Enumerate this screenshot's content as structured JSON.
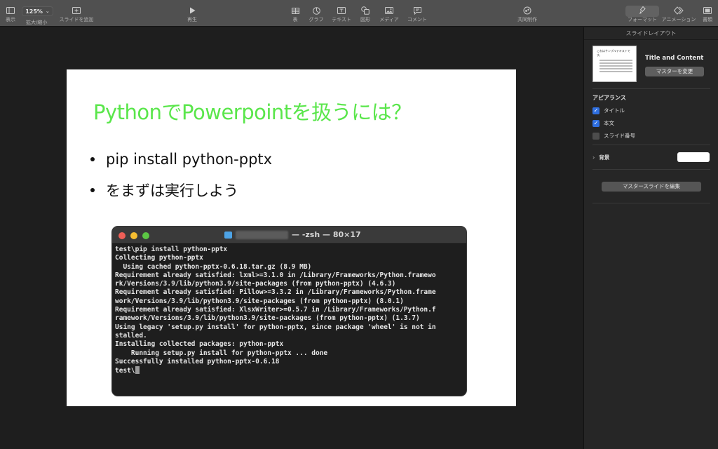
{
  "toolbar": {
    "view_label": "表示",
    "zoom_value": "125%",
    "zoom_label": "拡大/縮小",
    "add_slide_label": "スライドを追加",
    "play_label": "再生",
    "table_label": "表",
    "chart_label": "グラフ",
    "text_label": "テキスト",
    "shape_label": "図形",
    "media_label": "メディア",
    "comment_label": "コメント",
    "collaborate_label": "共同制作",
    "format_label": "フォーマット",
    "animate_label": "アニメーション",
    "document_label": "書類"
  },
  "slide": {
    "title": "PythonでPowerpointを扱うには？",
    "title_color": "#5ae64b",
    "bullets": [
      "pip install python-pptx",
      "をまずは実行しよう"
    ],
    "terminal": {
      "title": "— -zsh — 80×17",
      "lines": [
        "test\\pip install python-pptx",
        "Collecting python-pptx",
        "  Using cached python-pptx-0.6.18.tar.gz (8.9 MB)",
        "Requirement already satisfied: lxml>=3.1.0 in /Library/Frameworks/Python.framewo",
        "rk/Versions/3.9/lib/python3.9/site-packages (from python-pptx) (4.6.3)",
        "Requirement already satisfied: Pillow>=3.3.2 in /Library/Frameworks/Python.frame",
        "work/Versions/3.9/lib/python3.9/site-packages (from python-pptx) (8.0.1)",
        "Requirement already satisfied: XlsxWriter>=0.5.7 in /Library/Frameworks/Python.f",
        "ramework/Versions/3.9/lib/python3.9/site-packages (from python-pptx) (1.3.7)",
        "Using legacy 'setup.py install' for python-pptx, since package 'wheel' is not in",
        "stalled.",
        "Installing collected packages: python-pptx",
        "    Running setup.py install for python-pptx ... done",
        "Successfully installed python-pptx-0.6.18",
        "test\\"
      ]
    }
  },
  "inspector": {
    "header": "スライドレイアウト",
    "thumb_title": "これはサンプルテキストです。",
    "layout_name": "Title and Content",
    "change_master_label": "マスターを変更",
    "appearance_label": "アピアランス",
    "checks": [
      {
        "label": "タイトル",
        "checked": true
      },
      {
        "label": "本文",
        "checked": true
      },
      {
        "label": "スライド番号",
        "checked": false
      }
    ],
    "background_label": "背景",
    "background_color": "#ffffff",
    "edit_master_label": "マスタースライドを編集"
  }
}
